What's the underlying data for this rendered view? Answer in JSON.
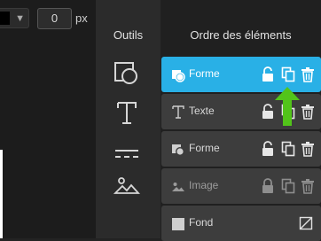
{
  "props": {
    "size_value": "0",
    "size_unit": "px"
  },
  "tools": {
    "title": "Outils"
  },
  "layers": {
    "title": "Ordre des éléments",
    "items": [
      {
        "label": "Forme"
      },
      {
        "label": "Texte"
      },
      {
        "label": "Forme"
      },
      {
        "label": "Image"
      },
      {
        "label": "Fond"
      }
    ]
  },
  "colors": {
    "accent": "#29b0e6",
    "arrow": "#52c41a"
  }
}
